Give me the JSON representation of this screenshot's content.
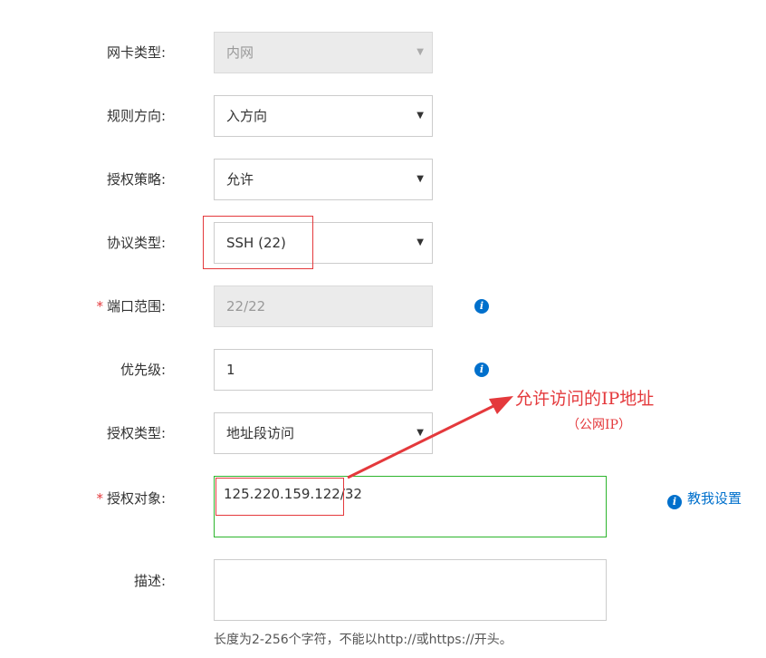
{
  "form": {
    "nic_type": {
      "label": "网卡类型:",
      "value": "内网",
      "disabled": true
    },
    "direction": {
      "label": "规则方向:",
      "value": "入方向"
    },
    "policy": {
      "label": "授权策略:",
      "value": "允许"
    },
    "protocol": {
      "label": "协议类型:",
      "value": "SSH (22)"
    },
    "port_range": {
      "label": "端口范围:",
      "value": "22/22",
      "required": "*",
      "disabled": true
    },
    "priority": {
      "label": "优先级:",
      "value": "1"
    },
    "auth_type": {
      "label": "授权类型:",
      "value": "地址段访问"
    },
    "auth_object": {
      "label": "授权对象:",
      "value": "125.220.159.122/32",
      "required": "*"
    },
    "description": {
      "label": "描述:",
      "value": "",
      "hint": "长度为2-256个字符，不能以http://或https://开头。"
    },
    "teach_link": "教我设置"
  },
  "annotation": {
    "title": "允许访问的IP地址",
    "subtitle": "（公网IP）",
    "color": "#e4393c"
  },
  "icons": {
    "dropdown": "▼",
    "info": "i"
  },
  "colors": {
    "accent": "#0070cc",
    "required": "#e4393c",
    "focus_border": "#2db52d"
  }
}
